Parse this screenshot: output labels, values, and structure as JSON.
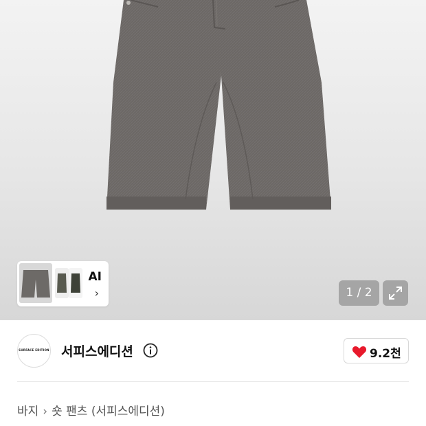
{
  "gallery": {
    "ai_label": "AI",
    "counter": "1 / 2",
    "chevron": "›"
  },
  "brand": {
    "logo_text": "SURFACE EDITION",
    "name": "서피스에디션"
  },
  "likes": {
    "count": "9.2천"
  },
  "breadcrumb": {
    "items": [
      "바지",
      "숏 팬츠 (서피스에디션)"
    ],
    "separator": "›"
  },
  "colors": {
    "heart": "#e8192c",
    "fabric": "#6e6a67"
  }
}
